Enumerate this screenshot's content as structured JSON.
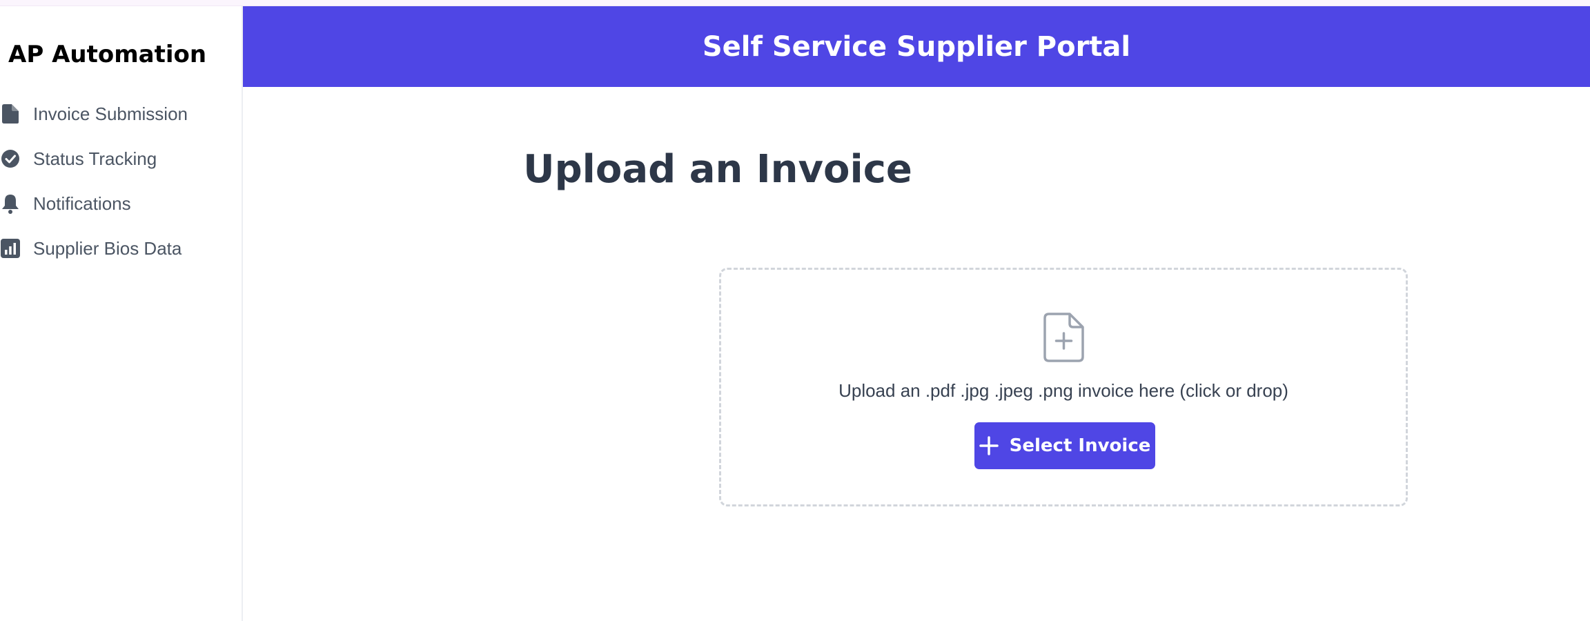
{
  "sidebar": {
    "brand": "AP Automation",
    "items": [
      {
        "label": "Invoice Submission",
        "icon": "document-icon"
      },
      {
        "label": "Status Tracking",
        "icon": "check-circle-icon"
      },
      {
        "label": "Notifications",
        "icon": "bell-icon"
      },
      {
        "label": "Supplier Bios Data",
        "icon": "bar-chart-icon"
      }
    ]
  },
  "header": {
    "title": "Self Service Supplier Portal"
  },
  "main": {
    "heading": "Upload an Invoice",
    "dropzone": {
      "icon": "file-plus-icon",
      "text": "Upload an .pdf .jpg .jpeg .png invoice here (click or drop)",
      "button_label": "Select Invoice"
    }
  },
  "colors": {
    "accent": "#4f46e5",
    "heading": "#2d3748",
    "sidebar_text": "#4b5563",
    "dropzone_border": "#d1d5db"
  }
}
